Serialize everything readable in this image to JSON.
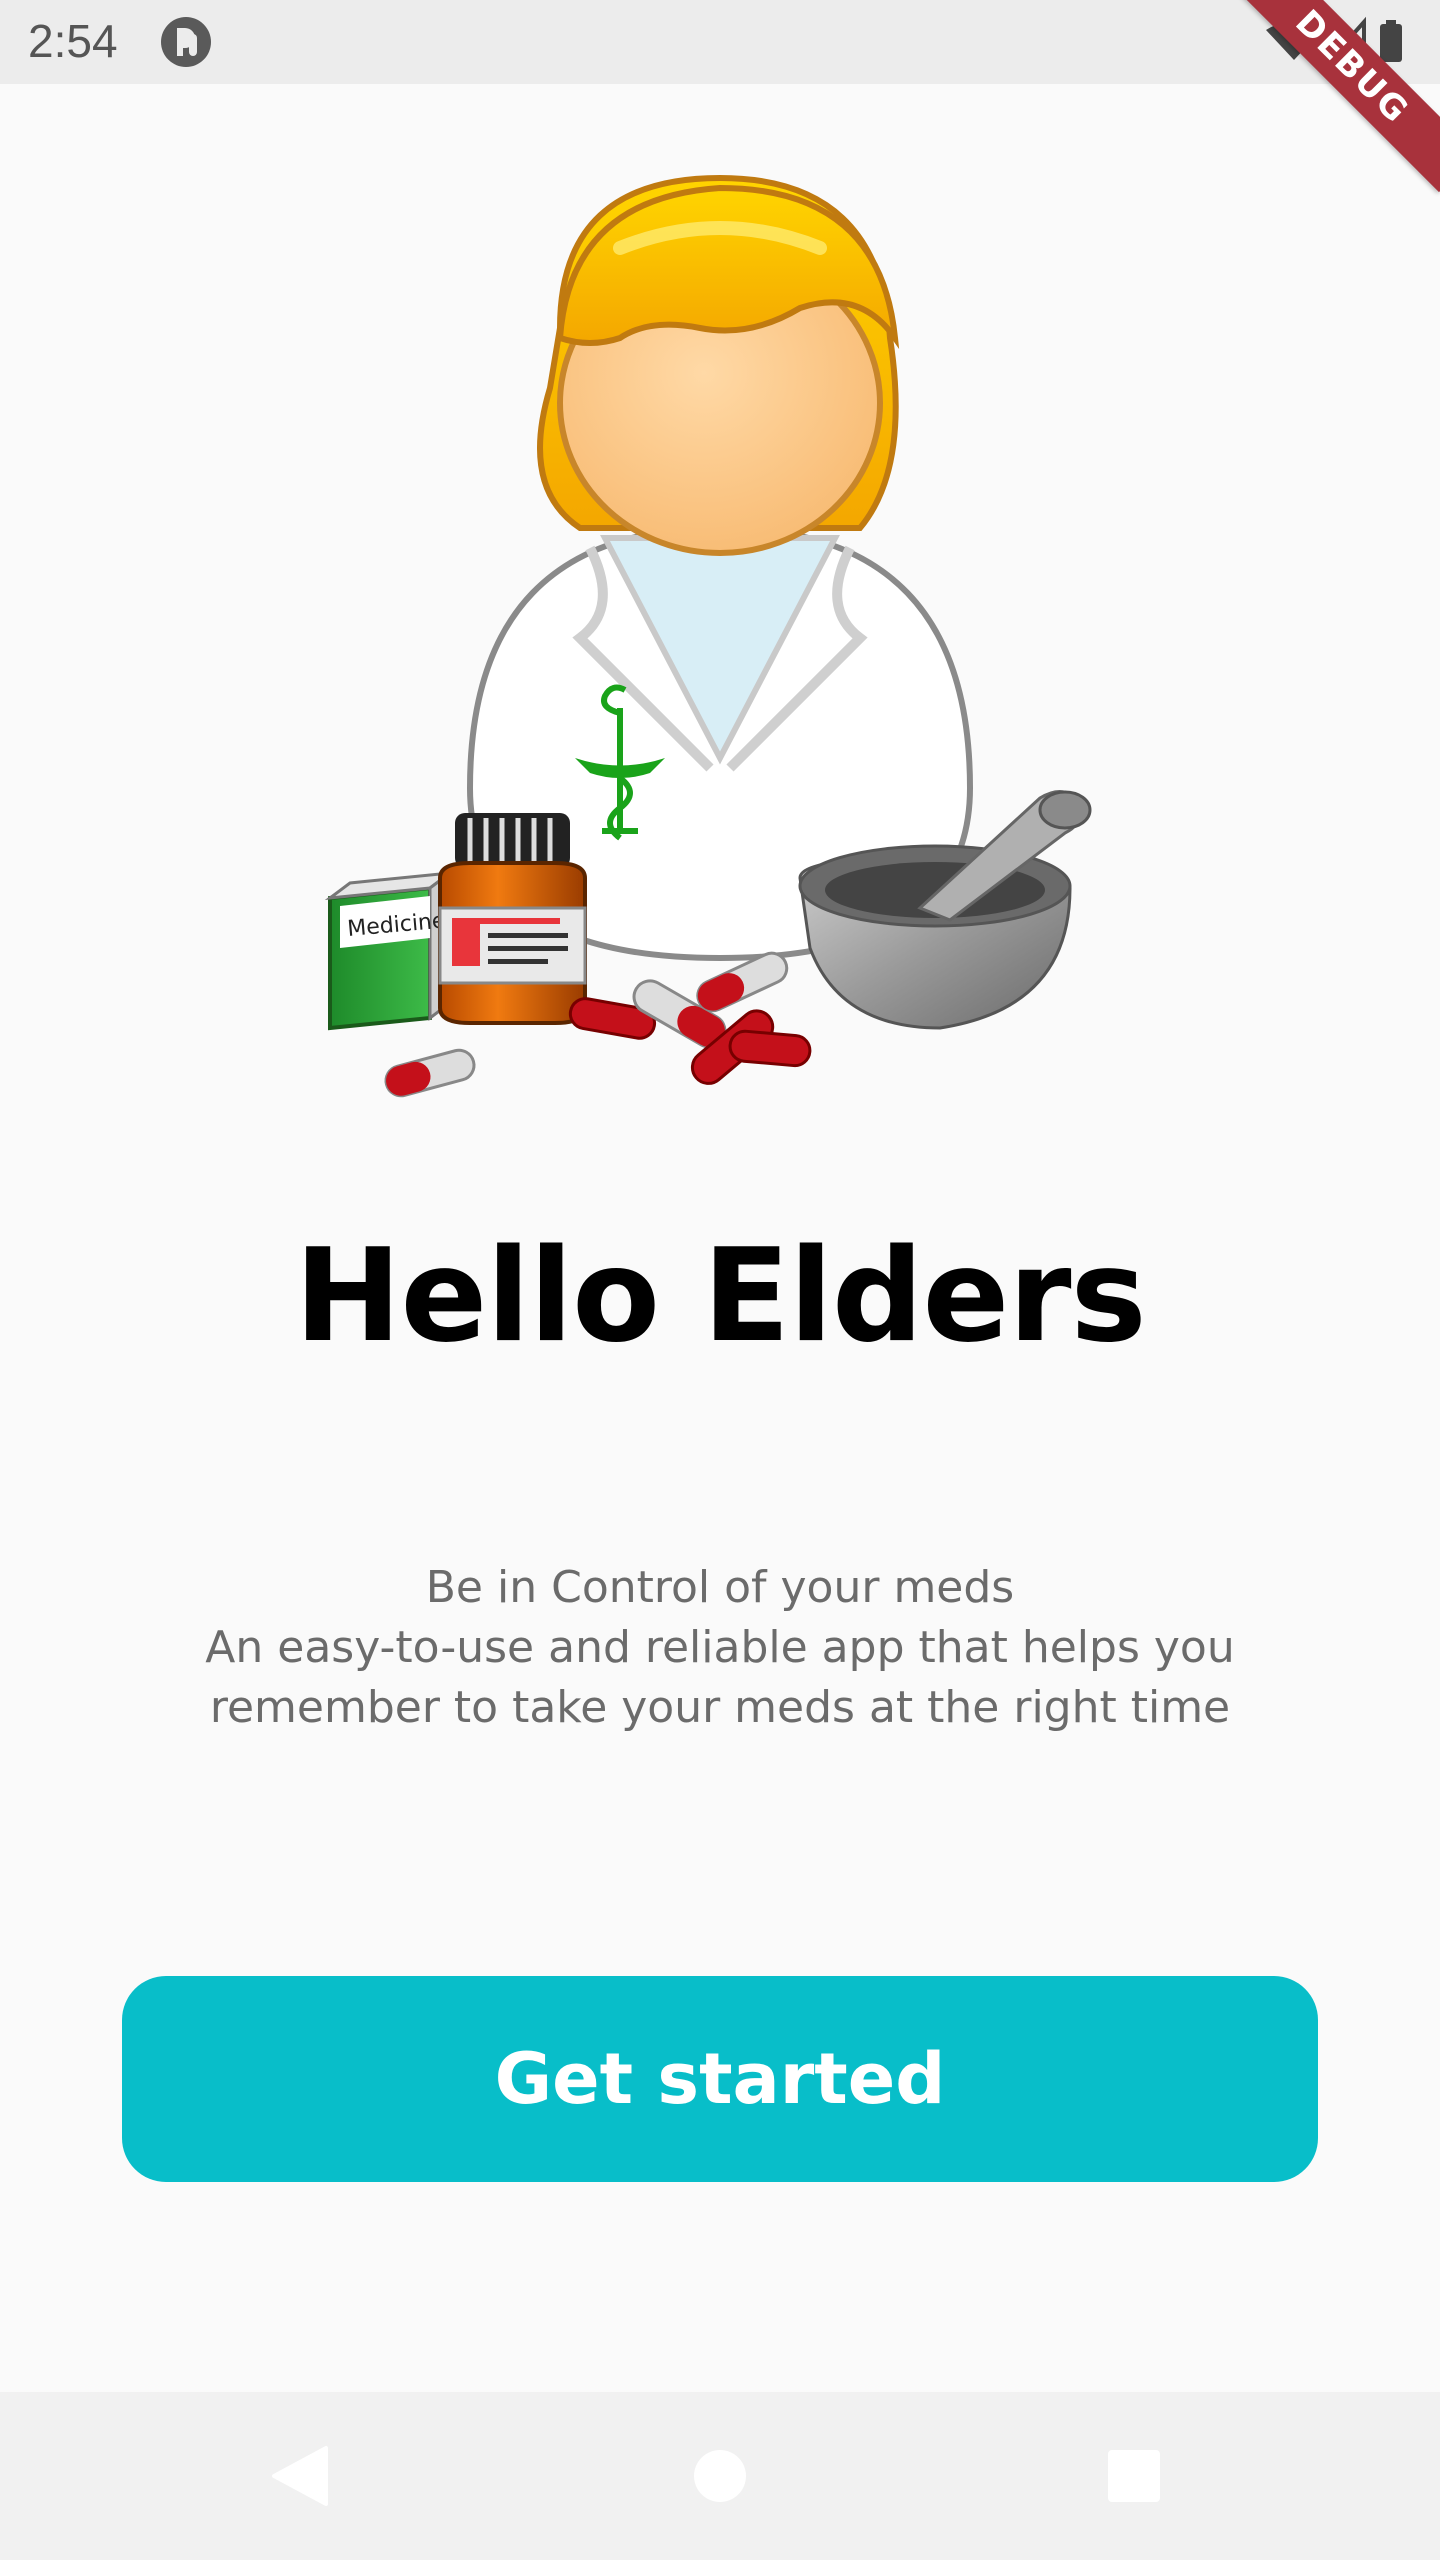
{
  "status_bar": {
    "time": "2:54",
    "app_icon": "app-notification-icon",
    "icons": [
      "wifi-icon",
      "signal-icon",
      "battery-icon"
    ]
  },
  "debug_banner": {
    "label": "DEBUG"
  },
  "illustration": {
    "box_label": "Medicine"
  },
  "welcome": {
    "title": "Hello Elders",
    "description_lines": [
      "Be in Control of your meds",
      "An easy-to-use and reliable app that helps you",
      "remember to take your meds at the right time"
    ]
  },
  "actions": {
    "get_started_label": "Get started"
  },
  "nav_bar": {
    "icons": [
      "back-icon",
      "home-icon",
      "recents-icon"
    ]
  },
  "colors": {
    "accent": "#08BEC9",
    "title": "#000000",
    "body_text": "#6B6B6B",
    "debug_banner": "#A8323C"
  }
}
